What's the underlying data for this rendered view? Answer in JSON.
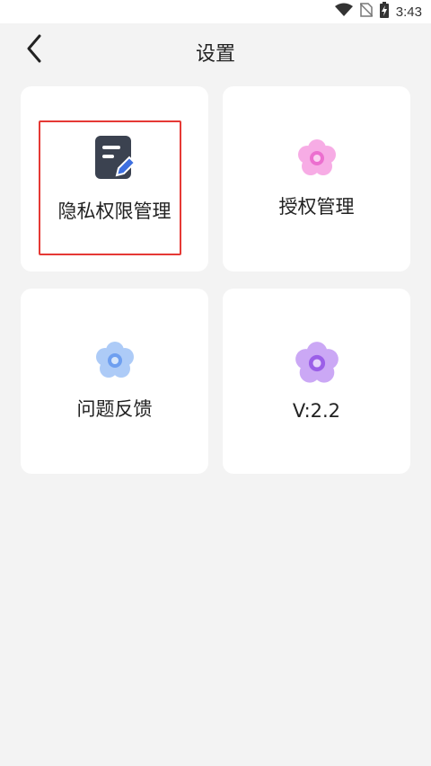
{
  "status_bar": {
    "time": "3:43",
    "icons": [
      "wifi-icon",
      "no-sim-icon",
      "battery-charging-icon"
    ]
  },
  "header": {
    "title": "设置",
    "back_icon": "chevron-left-icon"
  },
  "cards": [
    {
      "label": "隐私权限管理",
      "icon": "document-edit-icon",
      "highlighted": true
    },
    {
      "label": "授权管理",
      "icon": "pink-flower-icon",
      "color": "#f48fd8"
    },
    {
      "label": "问题反馈",
      "icon": "blue-flower-icon",
      "color": "#8fb8f5"
    },
    {
      "label": "V:2.2",
      "icon": "purple-flower-icon",
      "color": "#b07ef0"
    }
  ],
  "colors": {
    "background": "#f3f3f3",
    "card": "#ffffff",
    "highlight": "#e53935",
    "doc_icon": "#3b4250",
    "pen_accent": "#3d6fe0"
  }
}
